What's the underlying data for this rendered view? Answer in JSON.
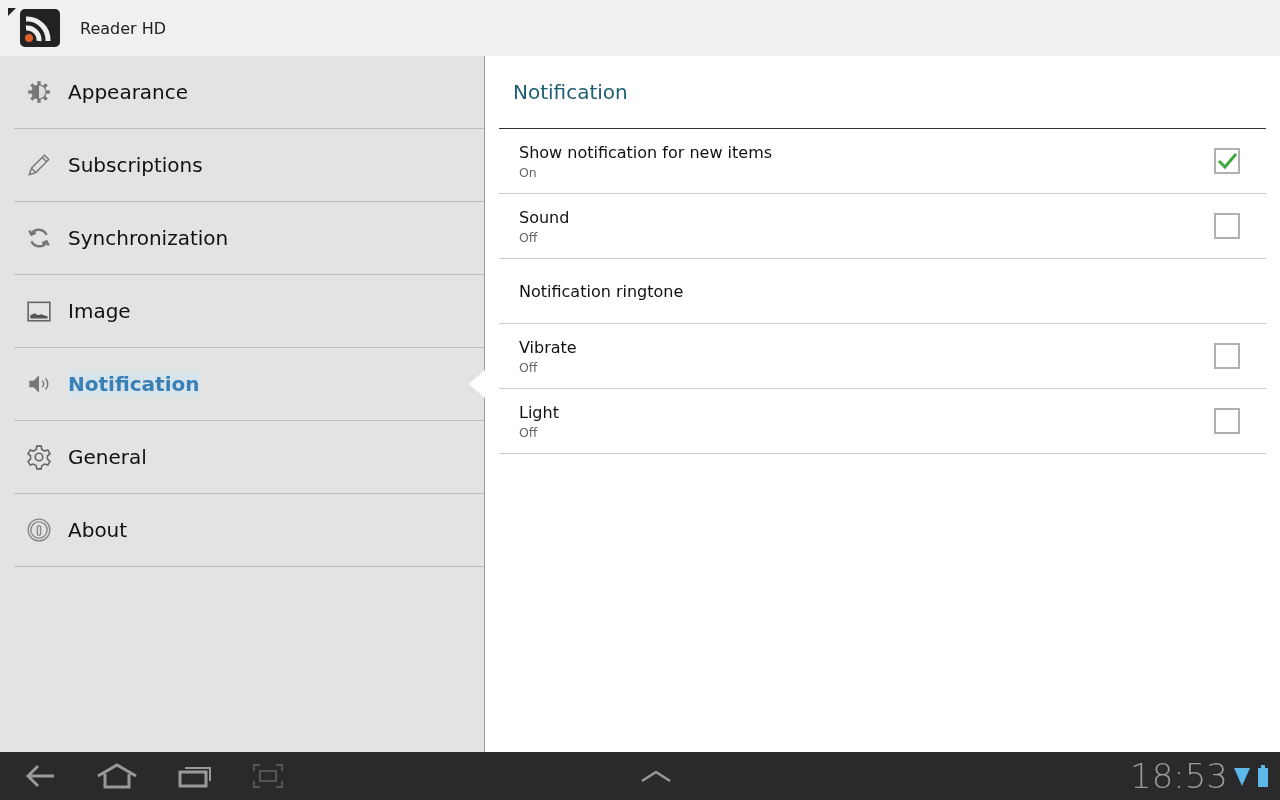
{
  "app_bar": {
    "title": "Reader HD"
  },
  "sidebar": {
    "items": [
      {
        "label": "Appearance",
        "selected": false
      },
      {
        "label": "Subscriptions",
        "selected": false
      },
      {
        "label": "Synchronization",
        "selected": false
      },
      {
        "label": "Image",
        "selected": false
      },
      {
        "label": "Notification",
        "selected": true
      },
      {
        "label": "General",
        "selected": false
      },
      {
        "label": "About",
        "selected": false
      }
    ]
  },
  "panel": {
    "title": "Notification",
    "settings": [
      {
        "kind": "checkbox",
        "title": "Show notification for new items",
        "summary": "On",
        "checked": true
      },
      {
        "kind": "checkbox",
        "title": "Sound",
        "summary": "Off",
        "checked": false
      },
      {
        "kind": "plain",
        "title": "Notification ringtone"
      },
      {
        "kind": "checkbox",
        "title": "Vibrate",
        "summary": "Off",
        "checked": false
      },
      {
        "kind": "checkbox",
        "title": "Light",
        "summary": "Off",
        "checked": false
      }
    ]
  },
  "status_bar": {
    "time": "18:53"
  }
}
